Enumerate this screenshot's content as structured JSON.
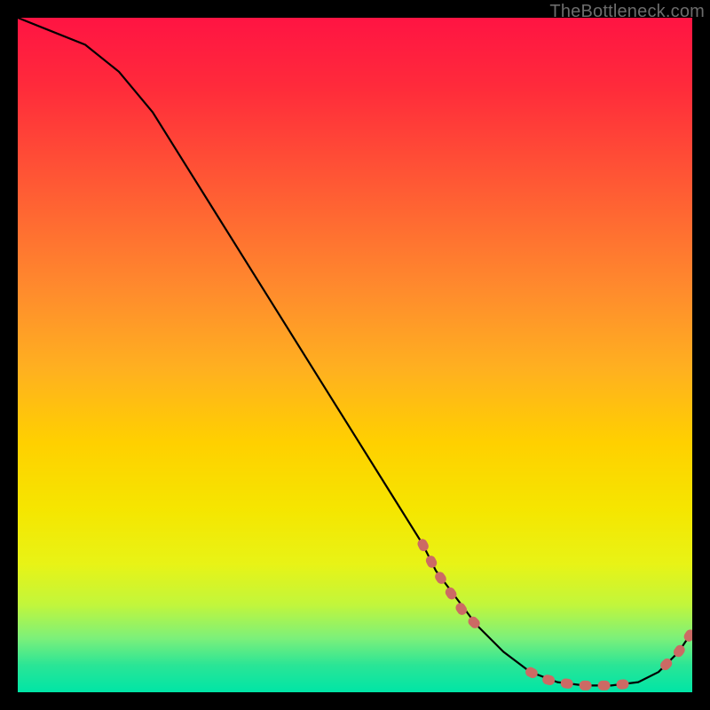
{
  "watermark": "TheBottleneck.com",
  "chart_data": {
    "type": "line",
    "title": "",
    "xlabel": "",
    "ylabel": "",
    "xlim": [
      0,
      100
    ],
    "ylim": [
      0,
      100
    ],
    "grid": false,
    "legend": false,
    "series": [
      {
        "name": "bottleneck-curve",
        "x": [
          0,
          5,
          10,
          15,
          20,
          25,
          30,
          35,
          40,
          45,
          50,
          55,
          60,
          62,
          65,
          68,
          72,
          76,
          80,
          84,
          88,
          92,
          95,
          98,
          100
        ],
        "y": [
          100,
          98,
          96,
          92,
          86,
          78,
          70,
          62,
          54,
          46,
          38,
          30,
          22,
          18,
          14,
          10,
          6,
          3,
          1.5,
          1,
          1,
          1.5,
          3,
          6,
          9
        ],
        "color": "#000000"
      }
    ],
    "markers": [
      {
        "name": "bottleneck-segment-dots",
        "color": "#cc6a64",
        "points": [
          {
            "x": 60,
            "y": 22
          },
          {
            "x": 62,
            "y": 18
          },
          {
            "x": 64,
            "y": 15
          },
          {
            "x": 66,
            "y": 12
          },
          {
            "x": 68,
            "y": 10
          },
          {
            "x": 76,
            "y": 3
          },
          {
            "x": 78,
            "y": 2
          },
          {
            "x": 80,
            "y": 1.5
          },
          {
            "x": 82,
            "y": 1.2
          },
          {
            "x": 84,
            "y": 1
          },
          {
            "x": 86,
            "y": 1
          },
          {
            "x": 88,
            "y": 1
          },
          {
            "x": 90,
            "y": 1.2
          },
          {
            "x": 92,
            "y": 1.5
          },
          {
            "x": 96,
            "y": 4
          },
          {
            "x": 98,
            "y": 6
          },
          {
            "x": 99,
            "y": 7.5
          },
          {
            "x": 100,
            "y": 9
          }
        ]
      }
    ],
    "background_gradient": {
      "orientation": "vertical",
      "stops": [
        {
          "pos": 0.0,
          "color": "#ff1443"
        },
        {
          "pos": 0.5,
          "color": "#ffb020"
        },
        {
          "pos": 0.75,
          "color": "#f5e600"
        },
        {
          "pos": 1.0,
          "color": "#00e5a6"
        }
      ]
    }
  }
}
